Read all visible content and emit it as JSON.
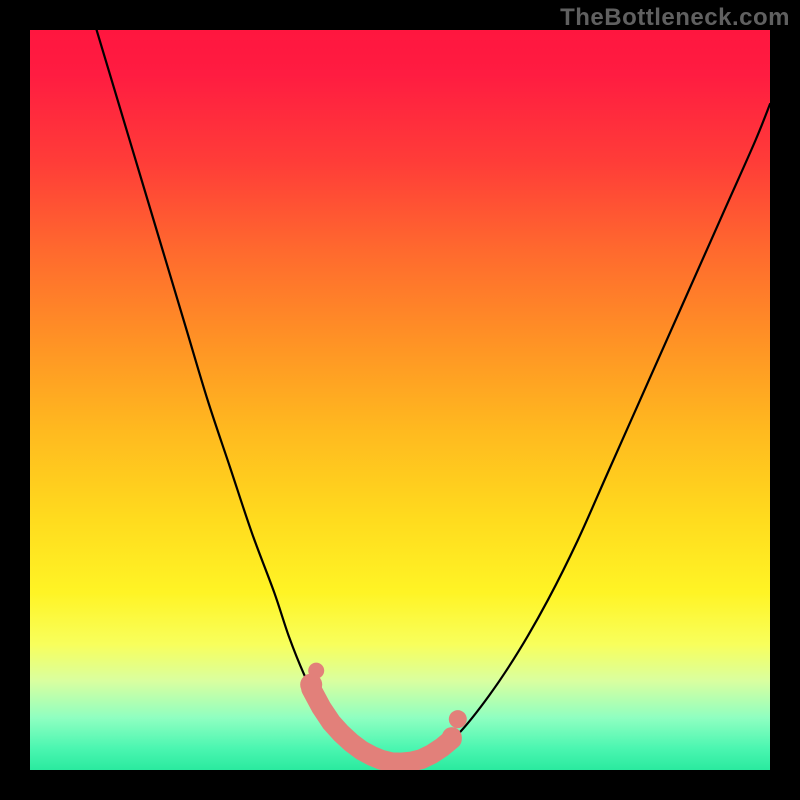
{
  "watermark": "TheBottleneck.com",
  "chart_data": {
    "type": "line",
    "title": "",
    "xlabel": "",
    "ylabel": "",
    "xlim": [
      0,
      100
    ],
    "ylim": [
      0,
      100
    ],
    "series": [
      {
        "name": "bottleneck-curve",
        "x": [
          9,
          12,
          15,
          18,
          21,
          24,
          27,
          30,
          33,
          35,
          37,
          39,
          41,
          43,
          45,
          47,
          49,
          51,
          53,
          55,
          58,
          62,
          66,
          70,
          74,
          78,
          82,
          86,
          90,
          94,
          98,
          100
        ],
        "values": [
          100,
          90,
          80,
          70,
          60,
          50,
          41,
          32,
          24,
          18,
          13,
          9,
          6,
          4,
          2.5,
          1.5,
          1,
          1,
          1.5,
          2.5,
          5,
          10,
          16,
          23,
          31,
          40,
          49,
          58,
          67,
          76,
          85,
          90
        ]
      }
    ],
    "annotations": [
      {
        "name": "valley-marker",
        "shape": "rounded-blob",
        "color": "#e2807a",
        "x_range": [
          38,
          57
        ],
        "y_level": 2
      }
    ],
    "background": {
      "type": "vertical-gradient",
      "stops": [
        {
          "pos": 0.0,
          "color": "#ff163f"
        },
        {
          "pos": 0.3,
          "color": "#ff6a2e"
        },
        {
          "pos": 0.6,
          "color": "#ffdb1e"
        },
        {
          "pos": 0.85,
          "color": "#f0ff70"
        },
        {
          "pos": 1.0,
          "color": "#2aea9f"
        }
      ]
    }
  }
}
